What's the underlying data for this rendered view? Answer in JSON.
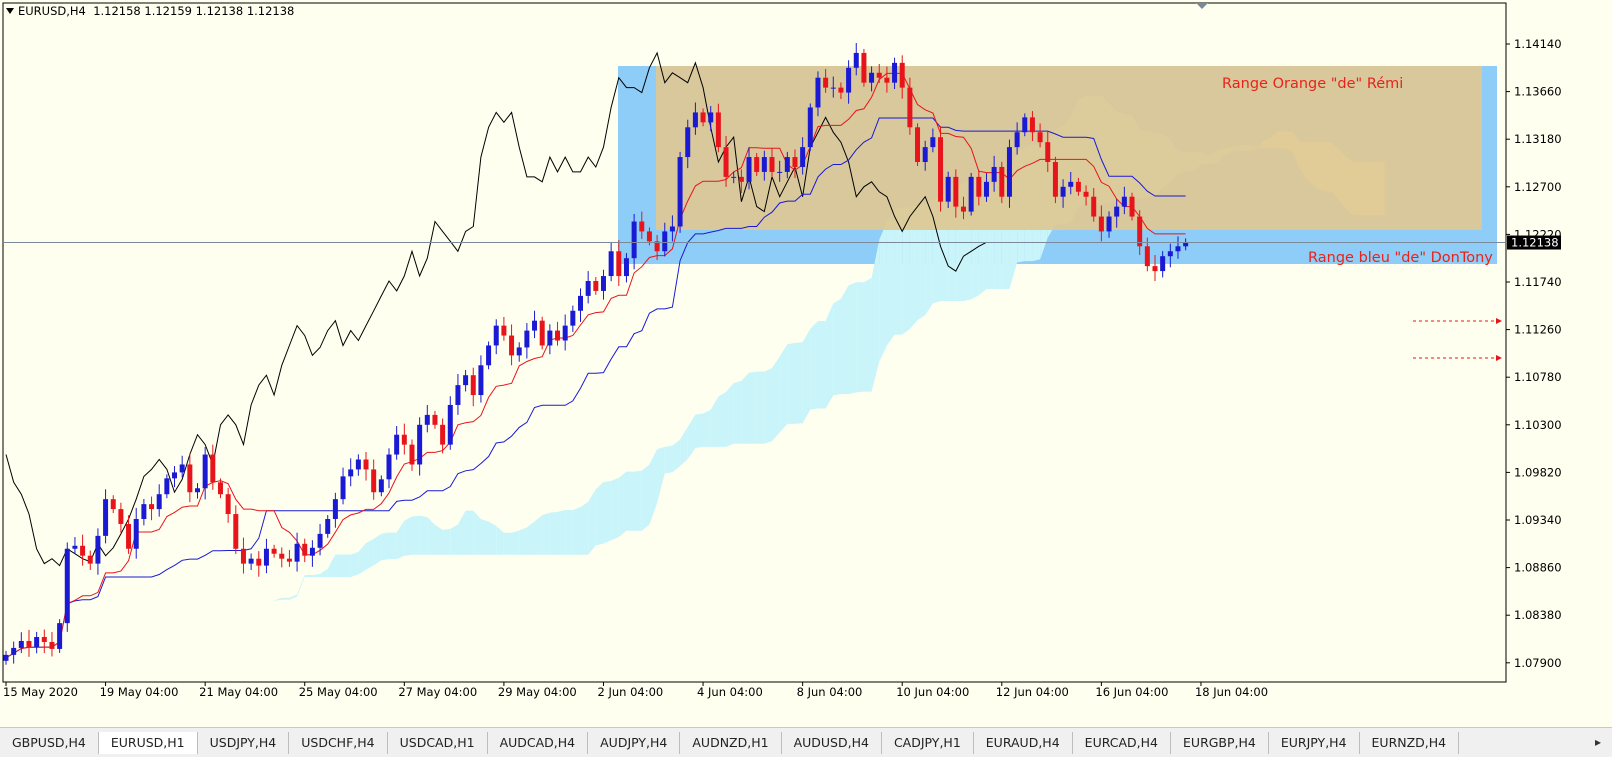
{
  "header": {
    "symbol": "EURUSD,H4",
    "ohlc": "1.12158 1.12159 1.12138 1.12138"
  },
  "annotations": {
    "orange_range": "Range Orange \"de\" Rémi",
    "blue_range": "Range bleu \"de\" DonTony"
  },
  "colors": {
    "background": "#fffff0",
    "bull_candle": "#1a1ad4",
    "bear_candle": "#e8141b",
    "tenkan": "#e8141b",
    "kijun": "#1a1ad4",
    "chikou": "#000000",
    "kumo_bull": "#c8f4fa",
    "kumo_bear": "#fbefb8",
    "blue_range": "#8ecdf8",
    "orange_range": "#dec892",
    "annotation_text": "#e8231b",
    "price_marker": "#000000"
  },
  "tabs": [
    {
      "label": "GBPUSD,H4"
    },
    {
      "label": "EURUSD,H1"
    },
    {
      "label": "USDJPY,H4"
    },
    {
      "label": "USDCHF,H4"
    },
    {
      "label": "USDCAD,H1"
    },
    {
      "label": "AUDCAD,H4"
    },
    {
      "label": "AUDJPY,H4"
    },
    {
      "label": "AUDNZD,H1"
    },
    {
      "label": "AUDUSD,H4"
    },
    {
      "label": "CADJPY,H1"
    },
    {
      "label": "EURAUD,H4"
    },
    {
      "label": "EURCAD,H4"
    },
    {
      "label": "EURGBP,H4"
    },
    {
      "label": "EURJPY,H4"
    },
    {
      "label": "EURNZD,H4"
    }
  ],
  "tab_scroll_icon": "arrow-right-icon",
  "chart_data": {
    "type": "candlestick",
    "symbol": "EURUSD",
    "timeframe": "H4",
    "current_price": 1.12138,
    "ylim": [
      1.076,
      1.144
    ],
    "y_ticks": [
      1.1414,
      1.1366,
      1.1318,
      1.127,
      1.1222,
      1.1174,
      1.1126,
      1.1078,
      1.103,
      1.0982,
      1.0934,
      1.0886,
      1.0838,
      1.079
    ],
    "x_ticks": [
      {
        "label": "15 May 2020",
        "bar": 0
      },
      {
        "label": "19 May 04:00",
        "bar": 13
      },
      {
        "label": "21 May 04:00",
        "bar": 26
      },
      {
        "label": "25 May 04:00",
        "bar": 39
      },
      {
        "label": "27 May 04:00",
        "bar": 52
      },
      {
        "label": "29 May 04:00",
        "bar": 65
      },
      {
        "label": "2 Jun 04:00",
        "bar": 78
      },
      {
        "label": "4 Jun 04:00",
        "bar": 91
      },
      {
        "label": "8 Jun 04:00",
        "bar": 104
      },
      {
        "label": "10 Jun 04:00",
        "bar": 117
      },
      {
        "label": "12 Jun 04:00",
        "bar": 130
      },
      {
        "label": "16 Jun 04:00",
        "bar": 143
      },
      {
        "label": "18 Jun 04:00",
        "bar": 156
      }
    ],
    "closes": [
      1.0798,
      1.0805,
      1.0812,
      1.0806,
      1.0816,
      1.0811,
      1.0804,
      1.083,
      1.0905,
      1.0908,
      1.0898,
      1.089,
      1.0918,
      1.0955,
      1.0945,
      1.093,
      1.0905,
      1.0935,
      1.095,
      1.0945,
      1.096,
      1.0976,
      1.0982,
      1.099,
      1.0962,
      1.0966,
      1.1,
      1.0972,
      1.096,
      1.094,
      1.0905,
      1.089,
      1.0895,
      1.0888,
      1.0905,
      1.09,
      1.0895,
      1.0892,
      1.091,
      1.0898,
      1.0906,
      1.092,
      1.0935,
      1.0955,
      1.0978,
      1.0985,
      1.0995,
      1.0985,
      1.0962,
      1.0975,
      1.1,
      1.102,
      1.101,
      1.099,
      1.103,
      1.104,
      1.103,
      1.101,
      1.105,
      1.107,
      1.108,
      1.106,
      1.109,
      1.111,
      1.113,
      1.112,
      1.11,
      1.1108,
      1.1125,
      1.1135,
      1.111,
      1.1125,
      1.1115,
      1.113,
      1.1145,
      1.116,
      1.1175,
      1.1165,
      1.118,
      1.1205,
      1.118,
      1.1198,
      1.1235,
      1.1225,
      1.1215,
      1.1205,
      1.1225,
      1.123,
      1.13,
      1.133,
      1.1345,
      1.1335,
      1.1345,
      1.131,
      1.128,
      1.128,
      1.1275,
      1.13,
      1.1285,
      1.13,
      1.1285,
      1.1285,
      1.13,
      1.129,
      1.131,
      1.135,
      1.138,
      1.137,
      1.137,
      1.1365,
      1.139,
      1.1405,
      1.1375,
      1.1385,
      1.138,
      1.1375,
      1.1395,
      1.137,
      1.133,
      1.1295,
      1.131,
      1.132,
      1.1255,
      1.128,
      1.125,
      1.1245,
      1.128,
      1.126,
      1.1275,
      1.129,
      1.126,
      1.131,
      1.1325,
      1.134,
      1.1325,
      1.1315,
      1.1295,
      1.126,
      1.127,
      1.1275,
      1.1265,
      1.126,
      1.124,
      1.1225,
      1.124,
      1.125,
      1.126,
      1.124,
      1.121,
      1.119,
      1.1185,
      1.12,
      1.1205,
      1.121,
      1.1214
    ]
  }
}
